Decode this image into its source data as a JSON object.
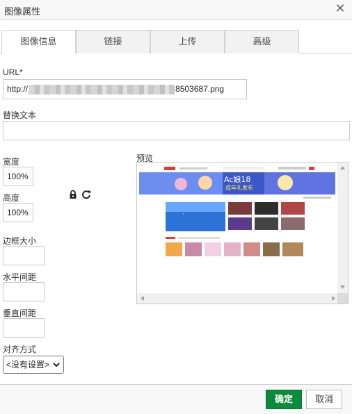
{
  "dialog": {
    "title": "图像属性",
    "close_glyph": "✕"
  },
  "tabs": [
    {
      "label": "图像信息",
      "active": true
    },
    {
      "label": "链接",
      "active": false
    },
    {
      "label": "上传",
      "active": false
    },
    {
      "label": "高级",
      "active": false
    }
  ],
  "form": {
    "url_label": "URL*",
    "url_prefix": "http://",
    "url_suffix": "8503687.png",
    "alt_label": "替换文本",
    "alt_value": "",
    "width_label": "宽度",
    "width_value": "100%",
    "height_label": "高度",
    "height_value": "100%",
    "border_label": "边框大小",
    "border_value": "",
    "hspace_label": "水平间距",
    "hspace_value": "",
    "vspace_label": "垂直间距",
    "vspace_value": "",
    "align_label": "对齐方式",
    "align_value": "<没有设置>",
    "lock_icon": "lock-icon",
    "reset_icon": "reset-icon"
  },
  "preview": {
    "label": "预览",
    "banner_text": "Ac娘18",
    "banner_subtext": "成年礼发布"
  },
  "footer": {
    "ok_label": "确定",
    "cancel_label": "取消"
  },
  "colors": {
    "ok_button": "#0b8b3c",
    "tab_inactive": "#f2f2f2",
    "border": "#d1d1d1"
  }
}
